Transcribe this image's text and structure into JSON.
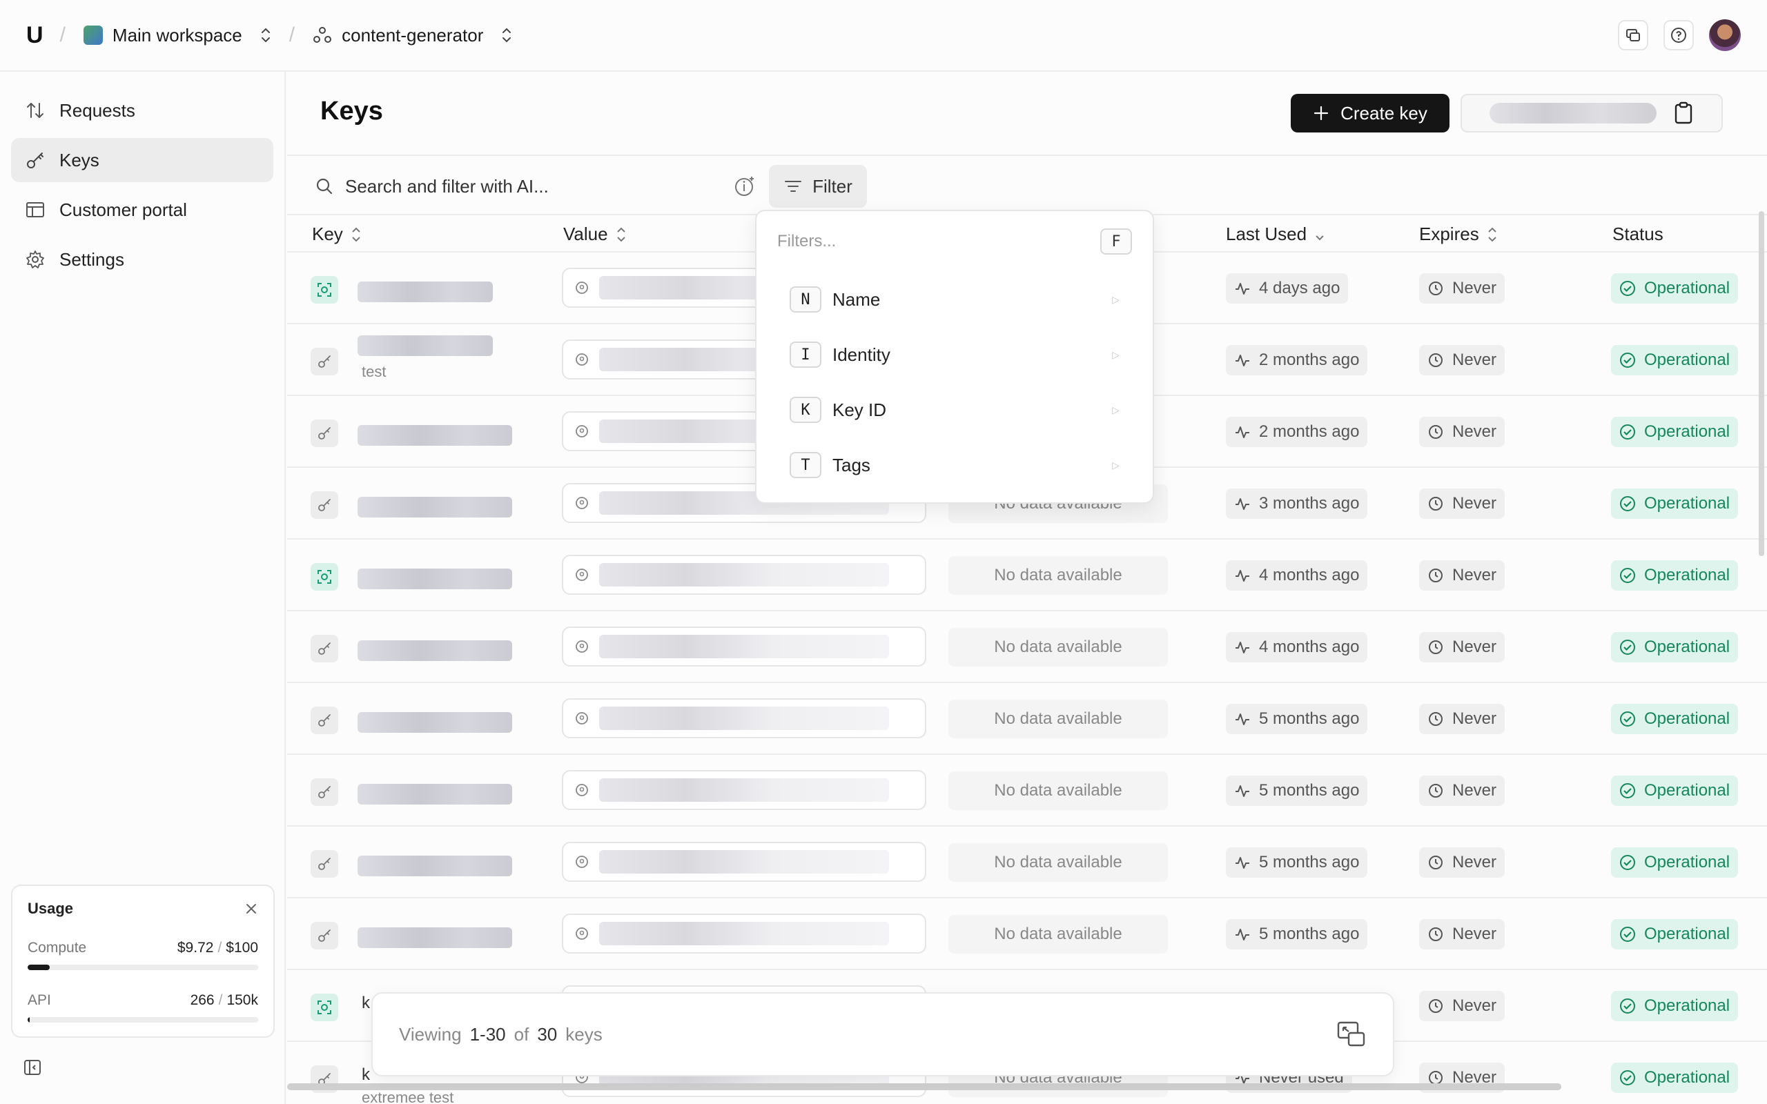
{
  "topbar": {
    "logo": "U",
    "workspace": "Main workspace",
    "project": "content-generator"
  },
  "sidebar": {
    "items": [
      {
        "label": "Requests",
        "icon": "arrows-updown-icon"
      },
      {
        "label": "Keys",
        "icon": "key-icon",
        "active": true
      },
      {
        "label": "Customer portal",
        "icon": "table-icon"
      },
      {
        "label": "Settings",
        "icon": "gear-icon"
      }
    ],
    "usage": {
      "title": "Usage",
      "compute_label": "Compute",
      "compute_used": "$9.72",
      "compute_limit": "$100",
      "compute_fraction": 0.0972,
      "api_label": "API",
      "api_used": "266",
      "api_limit": "150k",
      "api_fraction": 0.0018
    }
  },
  "main": {
    "title": "Keys",
    "create_label": "Create key",
    "search_placeholder": "Search and filter with AI...",
    "filter_label": "Filter",
    "columns": {
      "key": "Key",
      "value": "Value",
      "last_used": "Last Used",
      "expires": "Expires",
      "status": "Status"
    },
    "rows": [
      {
        "type": "root",
        "sub": "",
        "usage": "",
        "last_used": "4 days ago",
        "expires": "Never",
        "status": "Operational"
      },
      {
        "type": "key",
        "sub": "test",
        "usage": "",
        "last_used": "2 months ago",
        "expires": "Never",
        "status": "Operational"
      },
      {
        "type": "key",
        "sub": "",
        "usage": "",
        "last_used": "2 months ago",
        "expires": "Never",
        "status": "Operational"
      },
      {
        "type": "key",
        "sub": "",
        "usage": "No data available",
        "last_used": "3 months ago",
        "expires": "Never",
        "status": "Operational"
      },
      {
        "type": "root",
        "sub": "",
        "usage": "No data available",
        "last_used": "4 months ago",
        "expires": "Never",
        "status": "Operational"
      },
      {
        "type": "key",
        "sub": "",
        "usage": "No data available",
        "last_used": "4 months ago",
        "expires": "Never",
        "status": "Operational"
      },
      {
        "type": "key",
        "sub": "",
        "usage": "No data available",
        "last_used": "5 months ago",
        "expires": "Never",
        "status": "Operational"
      },
      {
        "type": "key",
        "sub": "",
        "usage": "No data available",
        "last_used": "5 months ago",
        "expires": "Never",
        "status": "Operational"
      },
      {
        "type": "key",
        "sub": "",
        "usage": "No data available",
        "last_used": "5 months ago",
        "expires": "Never",
        "status": "Operational"
      },
      {
        "type": "key",
        "sub": "",
        "usage": "No data available",
        "last_used": "5 months ago",
        "expires": "Never",
        "status": "Operational"
      },
      {
        "type": "root",
        "name_partial": "k",
        "sub": "",
        "usage": "",
        "last_used": "",
        "expires": "Never",
        "status": "Operational"
      },
      {
        "type": "key",
        "name_partial": "k",
        "sub": "extremee test",
        "usage": "No data available",
        "last_used": "Never used",
        "expires": "Never",
        "status": "Operational"
      }
    ]
  },
  "filter_menu": {
    "placeholder": "Filters...",
    "shortcut": "F",
    "items": [
      {
        "letter": "N",
        "label": "Name"
      },
      {
        "letter": "I",
        "label": "Identity"
      },
      {
        "letter": "K",
        "label": "Key ID"
      },
      {
        "letter": "T",
        "label": "Tags"
      }
    ]
  },
  "footer": {
    "viewing": "Viewing",
    "range": "1-30",
    "of": "of",
    "total": "30",
    "unit": "keys"
  },
  "colors": {
    "status_bg": "#dff4ec",
    "status_text": "#14875d",
    "root_icon_bg": "#d8f2ea",
    "primary_button": "#151515"
  }
}
